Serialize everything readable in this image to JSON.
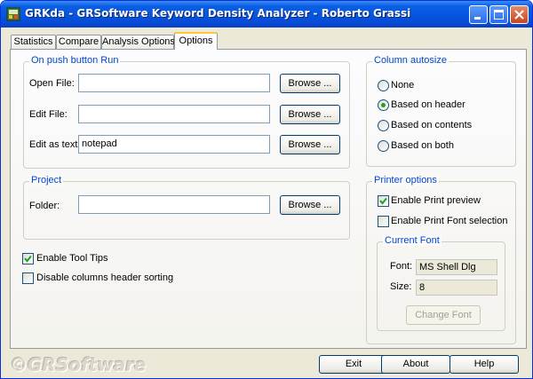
{
  "window": {
    "title": "GRKda - GRSoftware Keyword Density Analyzer - Roberto Grassi"
  },
  "tabs": [
    {
      "label": "Statistics"
    },
    {
      "label": "Compare"
    },
    {
      "label": "Analysis Options"
    },
    {
      "label": "Options",
      "active": true
    }
  ],
  "push_run": {
    "legend": "On push button Run",
    "open_file_label": "Open File:",
    "open_file_value": "",
    "edit_file_label": "Edit File:",
    "edit_file_value": "",
    "edit_text_label": "Edit as text:",
    "edit_text_value": "notepad",
    "browse_label": "Browse ..."
  },
  "project": {
    "legend": "Project",
    "folder_label": "Folder:",
    "folder_value": "",
    "browse_label": "Browse ..."
  },
  "options": {
    "tooltips_label": "Enable Tool Tips",
    "tooltips_checked": true,
    "sorting_label": "Disable columns header sorting",
    "sorting_checked": false
  },
  "column_autosize": {
    "legend": "Column autosize",
    "options": [
      "None",
      "Based on header",
      "Based on contents",
      "Based on both"
    ],
    "selected": 1
  },
  "printer": {
    "legend": "Printer options",
    "preview_label": "Enable Print preview",
    "preview_checked": true,
    "font_sel_label": "Enable Print Font selection",
    "font_sel_checked": false,
    "current_font_legend": "Current Font",
    "font_label": "Font:",
    "font_value": "MS Shell Dlg",
    "size_label": "Size:",
    "size_value": "8",
    "change_font_label": "Change Font"
  },
  "footer": {
    "brand": "©GRSoftware",
    "exit_label": "Exit",
    "about_label": "About",
    "help_label": "Help"
  },
  "colors": {
    "titlebar": "#0655e0",
    "legend_text": "#0046d5",
    "active_tab_accent": "#ffc83c",
    "checkmark": "#21a121"
  },
  "icons": {
    "app": "grkda-app-icon",
    "minimize": "minimize-icon",
    "maximize": "maximize-icon",
    "close": "close-icon"
  }
}
